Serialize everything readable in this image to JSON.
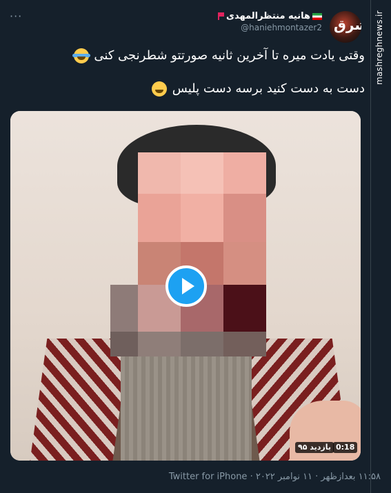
{
  "watermark": "mashreghnews.ir",
  "tweet": {
    "display_name": "هانیه منتظرالمهدی",
    "handle": "@haniehmontazer2",
    "avatar_text": "مشرق",
    "more_label": "···",
    "line1": "وقتی یادت میره تا آخرین ثانیه صورتتو شطرنجی کنی",
    "line2": "دست به دست کنید برسه دست پلیس",
    "video": {
      "duration": "0:18",
      "views": "۹۵ بازدید"
    },
    "timestamp": "۱۱:۵۸ بعدازظهر · ۱۱ نوامبر ۲۰۲۲ · ",
    "source": "Twitter for iPhone"
  },
  "colors": {
    "background": "#15202b",
    "muted": "#8899a6",
    "accent": "#1da1f2"
  },
  "icons": [
    "more-icon",
    "flag-iran-icon",
    "flag-red-icon",
    "emoji-tears-of-joy-icon",
    "emoji-grin-icon",
    "play-icon"
  ]
}
